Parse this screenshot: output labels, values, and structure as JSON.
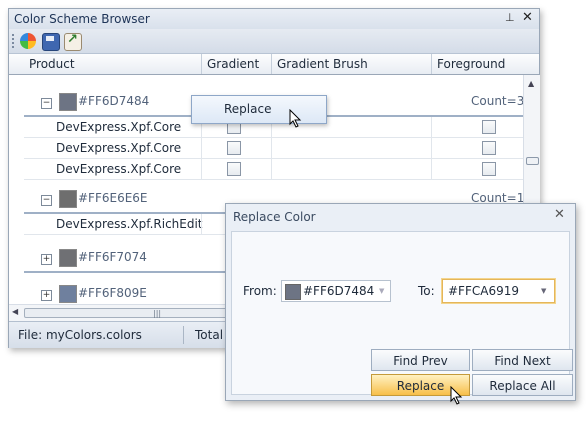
{
  "panel": {
    "title": "Color Scheme Browser",
    "pin_glyph": "⊥",
    "close_glyph": "✕"
  },
  "toolbar": {
    "icons": [
      "color-palette-icon",
      "save-icon",
      "export-icon"
    ]
  },
  "grid": {
    "columns": [
      "Product",
      "Gradient",
      "Gradient Brush",
      "Foreground"
    ],
    "groups": [
      {
        "label": "#FF6D7484",
        "swatch": "#6D7484",
        "count": "Count=3",
        "expanded": true,
        "rows": [
          {
            "product": "DevExpress.Xpf.Core"
          },
          {
            "product": "DevExpress.Xpf.Core"
          },
          {
            "product": "DevExpress.Xpf.Core"
          }
        ]
      },
      {
        "label": "#FF6E6E6E",
        "swatch": "#6E6E6E",
        "count": "Count=1",
        "expanded": true,
        "rows": [
          {
            "product": "DevExpress.Xpf.RichEdit"
          }
        ]
      },
      {
        "label": "#FF6F7074",
        "swatch": "#6F7074",
        "expanded": false
      },
      {
        "label": "#FF6F809E",
        "swatch": "#6F809E",
        "expanded": false
      }
    ]
  },
  "status": {
    "file": "File: myColors.colors",
    "total": "Total"
  },
  "context_button": {
    "label": "Replace"
  },
  "dialog": {
    "title": "Replace Color",
    "close_glyph": "✕",
    "from_label": "From:",
    "from_value": "#FF6D7484",
    "from_swatch": "#6D7484",
    "to_label": "To:",
    "to_value": "#FFCA6919",
    "buttons": {
      "find_prev": "Find Prev",
      "find_next": "Find Next",
      "replace": "Replace",
      "replace_all": "Replace All"
    }
  }
}
